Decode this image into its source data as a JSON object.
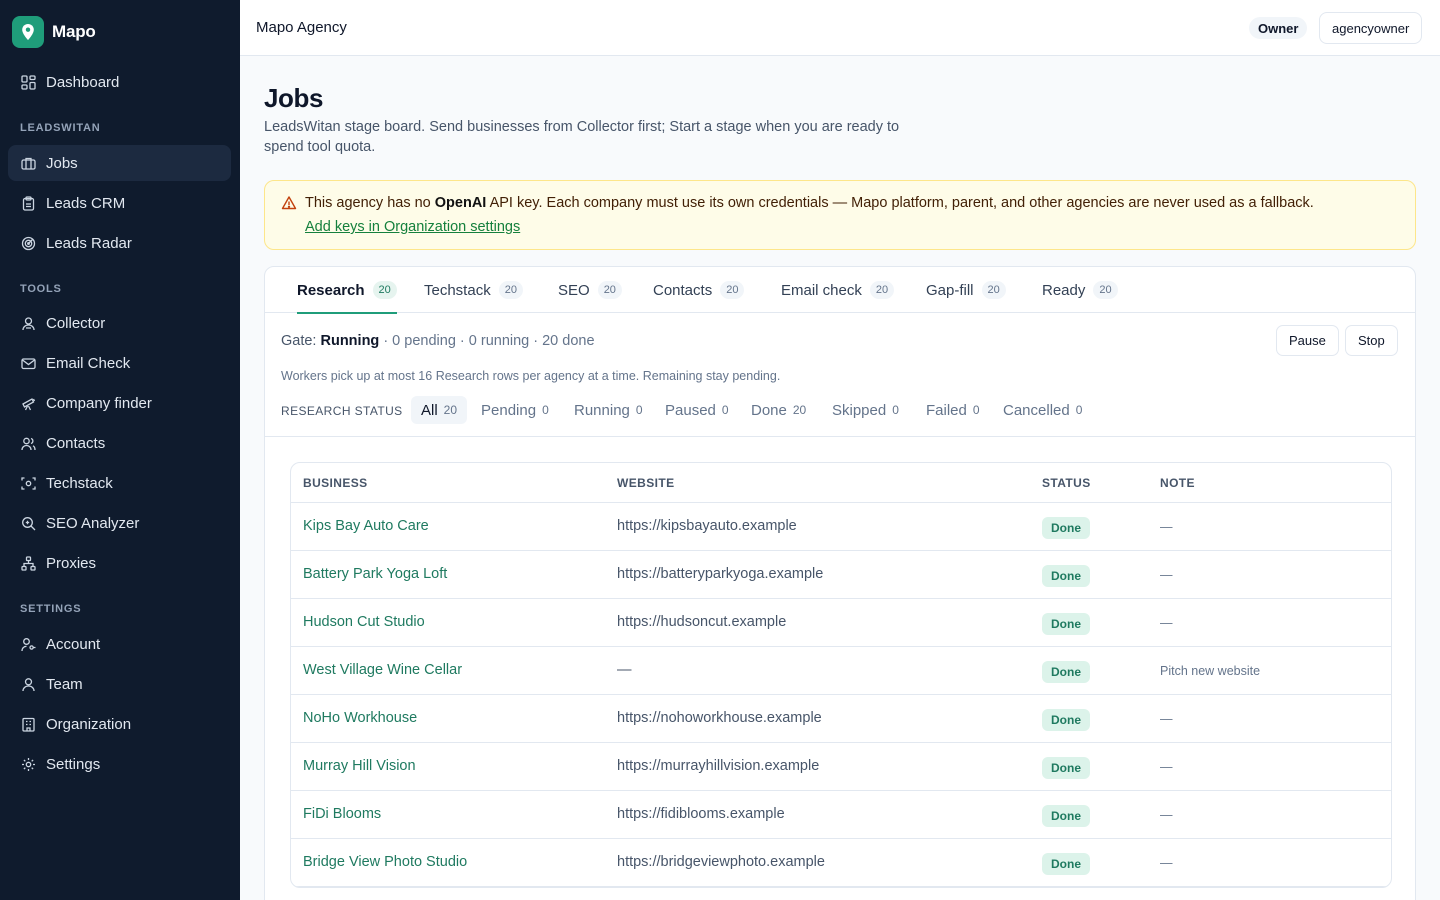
{
  "app": {
    "name": "Mapo"
  },
  "sidebar": {
    "dashboard": "Dashboard",
    "sections": {
      "leadswitan": "LEADSWITAN",
      "tools": "TOOLS",
      "settings": "SETTINGS"
    },
    "leadswitan_items": [
      {
        "label": "Jobs",
        "icon": "briefcase-icon",
        "active": true
      },
      {
        "label": "Leads CRM",
        "icon": "clipboard-icon"
      },
      {
        "label": "Leads Radar",
        "icon": "radar-icon"
      }
    ],
    "tools_items": [
      {
        "label": "Collector",
        "icon": "user-scan-icon"
      },
      {
        "label": "Email Check",
        "icon": "mail-icon"
      },
      {
        "label": "Company finder",
        "icon": "telescope-icon"
      },
      {
        "label": "Contacts",
        "icon": "users-icon"
      },
      {
        "label": "Techstack",
        "icon": "scan-icon"
      },
      {
        "label": "SEO Analyzer",
        "icon": "search-icon"
      },
      {
        "label": "Proxies",
        "icon": "network-icon"
      }
    ],
    "settings_items": [
      {
        "label": "Account",
        "icon": "user-key-icon"
      },
      {
        "label": "Team",
        "icon": "team-icon"
      },
      {
        "label": "Organization",
        "icon": "building-icon"
      },
      {
        "label": "Settings",
        "icon": "gear-icon"
      }
    ]
  },
  "topbar": {
    "title": "Mapo Agency",
    "role": "Owner",
    "user": "agencyowner"
  },
  "page": {
    "title": "Jobs",
    "description": "LeadsWitan stage board. Send businesses from Collector first; Start a stage when you are ready to spend tool quota."
  },
  "alert": {
    "prefix": "This agency has no ",
    "key_name": "OpenAI",
    "suffix": " API key. Each company must use its own credentials — Mapo platform, parent, and other agencies are never used as a fallback.",
    "link": "Add keys in Organization settings",
    "icon": "warning-triangle-icon"
  },
  "tabs": [
    {
      "label": "Research",
      "count": "20",
      "active": true
    },
    {
      "label": "Techstack",
      "count": "20"
    },
    {
      "label": "SEO",
      "count": "20"
    },
    {
      "label": "Contacts",
      "count": "20"
    },
    {
      "label": "Email check",
      "count": "20"
    },
    {
      "label": "Gap-fill",
      "count": "20"
    },
    {
      "label": "Ready",
      "count": "20"
    }
  ],
  "gate": {
    "label": "Gate: ",
    "state": "Running",
    "summary": " · 0 pending · 0 running · 20 done",
    "pause": "Pause",
    "stop": "Stop",
    "workers_note": "Workers pick up at most 16 Research rows per agency at a time. Remaining stay pending."
  },
  "filters": {
    "label": "RESEARCH STATUS",
    "items": [
      {
        "label": "All",
        "count": "20",
        "active": true
      },
      {
        "label": "Pending",
        "count": "0"
      },
      {
        "label": "Running",
        "count": "0"
      },
      {
        "label": "Paused",
        "count": "0"
      },
      {
        "label": "Done",
        "count": "20"
      },
      {
        "label": "Skipped",
        "count": "0"
      },
      {
        "label": "Failed",
        "count": "0"
      },
      {
        "label": "Cancelled",
        "count": "0"
      }
    ]
  },
  "table": {
    "columns": [
      "BUSINESS",
      "WEBSITE",
      "STATUS",
      "NOTE"
    ],
    "rows": [
      {
        "business": "Kips Bay Auto Care",
        "website": "https://kipsbayauto.example",
        "status": "Done",
        "note": "—"
      },
      {
        "business": "Battery Park Yoga Loft",
        "website": "https://batteryparkyoga.example",
        "status": "Done",
        "note": "—"
      },
      {
        "business": "Hudson Cut Studio",
        "website": "https://hudsoncut.example",
        "status": "Done",
        "note": "—"
      },
      {
        "business": "West Village Wine Cellar",
        "website": "—",
        "status": "Done",
        "note": "Pitch new website"
      },
      {
        "business": "NoHo Workhouse",
        "website": "https://nohoworkhouse.example",
        "status": "Done",
        "note": "—"
      },
      {
        "business": "Murray Hill Vision",
        "website": "https://murrayhillvision.example",
        "status": "Done",
        "note": "—"
      },
      {
        "business": "FiDi Blooms",
        "website": "https://fidiblooms.example",
        "status": "Done",
        "note": "—"
      },
      {
        "business": "Bridge View Photo Studio",
        "website": "https://bridgeviewphoto.example",
        "status": "Done",
        "note": "—"
      }
    ]
  }
}
